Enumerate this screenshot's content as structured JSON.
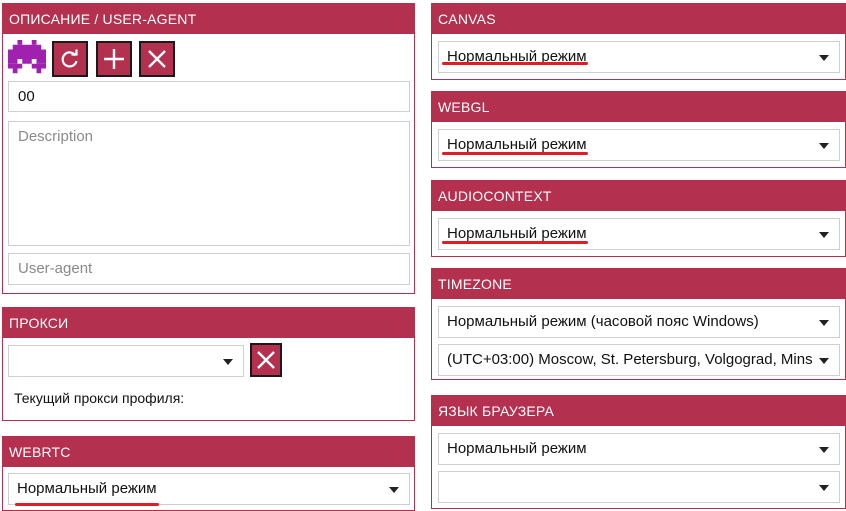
{
  "description_panel": {
    "title": "ОПИСАНИЕ / USER-AGENT",
    "name_value": "00",
    "description_placeholder": "Description",
    "user_agent_placeholder": "User-agent"
  },
  "proxy_panel": {
    "title": "ПРОКСИ",
    "proxy_select_value": "",
    "current_proxy_label": "Текущий прокси профиля:"
  },
  "webrtc_panel": {
    "title": "WEBRTC",
    "mode": "Нормальный режим"
  },
  "canvas_panel": {
    "title": "CANVAS",
    "mode": "Нормальный режим"
  },
  "webgl_panel": {
    "title": "WEBGL",
    "mode": "Нормальный режим"
  },
  "audiocontext_panel": {
    "title": "AUDIOCONTEXT",
    "mode": "Нормальный режим"
  },
  "timezone_panel": {
    "title": "TIMEZONE",
    "mode": "Нормальный режим (часовой пояс Windows)",
    "zone": "(UTC+03:00) Moscow, St. Petersburg, Volgograd, Mins"
  },
  "language_panel": {
    "title": "ЯЗЫК БРАУЗЕРА",
    "mode": "Нормальный режим",
    "language": ""
  },
  "colors": {
    "accent": "#b3304f",
    "icon_purple": "#a020b0",
    "underline_red": "#e01c25"
  },
  "icons": [
    "identicon-icon",
    "refresh-icon",
    "plus-icon",
    "close-icon",
    "chevron-down-icon"
  ]
}
